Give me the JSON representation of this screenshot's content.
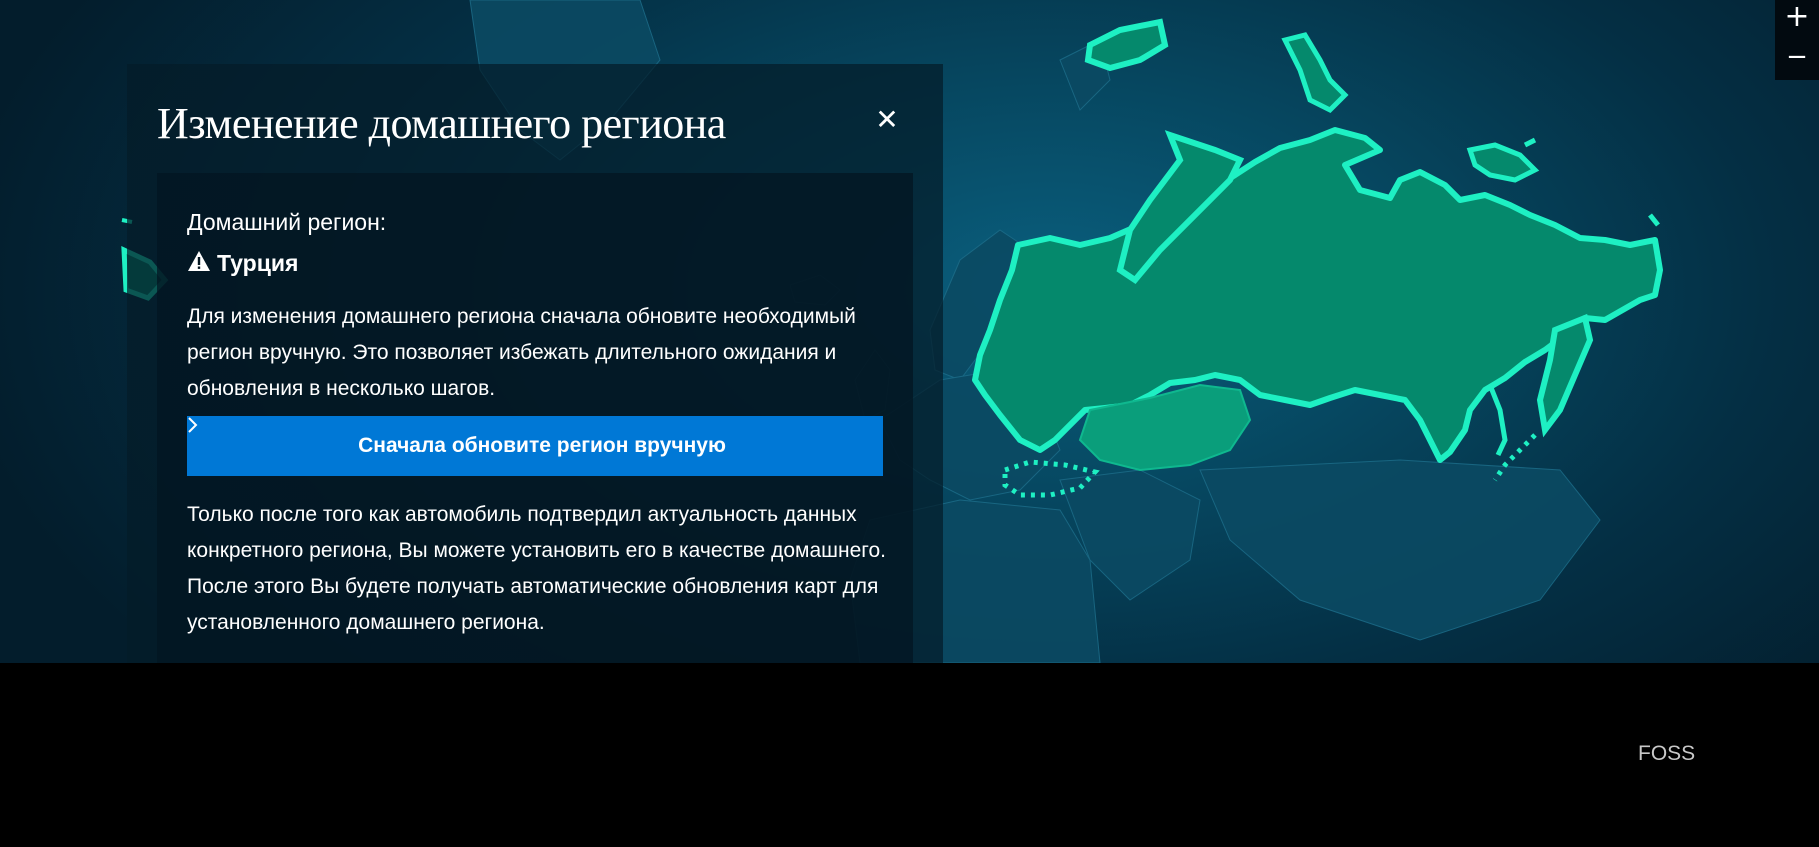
{
  "map": {
    "zoom_in_label": "+",
    "zoom_out_label": "−",
    "highlight_color": "#1ef0c3",
    "fill_color": "#05896c"
  },
  "dialog": {
    "title": "Изменение домашнего региона",
    "close_label": "✕",
    "home_region_label": "Домашний регион:",
    "home_region_value": "Турция",
    "warning_icon": "warning-triangle-icon",
    "description": "Для изменения домашнего региона сначала обновите необходимый регион вручную. Это позволяет избежать длительного ожидания и обновления в несколько шагов.",
    "button_label": "Сначала обновите регион вручную",
    "button_color": "#0078d6",
    "note": "Только после того как автомобиль подтвердил актуальность данных конкретного региона, Вы можете установить его в качестве домашнего. После этого Вы будете получать автоматические обновления карт для установленного домашнего региона."
  },
  "footer": {
    "foss_label": "FOSS"
  }
}
